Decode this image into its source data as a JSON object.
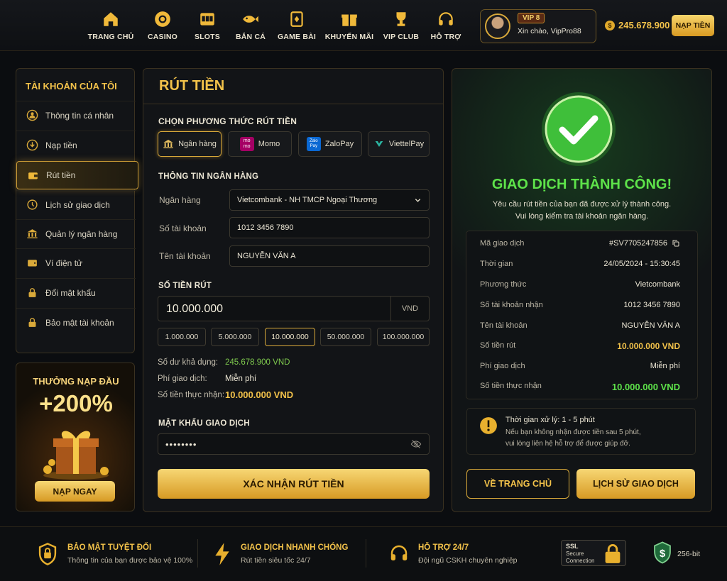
{
  "nav": [
    {
      "label": "TRANG CHỦ",
      "icon": "home-icon"
    },
    {
      "label": "CASINO",
      "icon": "chip-icon"
    },
    {
      "label": "SLOTS",
      "icon": "slot-machine-icon"
    },
    {
      "label": "BẮN CÁ",
      "icon": "fish-icon"
    },
    {
      "label": "GAME BÀI",
      "icon": "cards-icon"
    },
    {
      "label": "KHUYẾN MÃI",
      "icon": "gift-icon"
    },
    {
      "label": "VIP CLUB",
      "icon": "trophy-icon"
    },
    {
      "label": "HỖ TRỢ",
      "icon": "headset-icon"
    }
  ],
  "user": {
    "vip": "VIP 8",
    "greeting": "Xin chào, VipPro88",
    "balance": "245.678.900",
    "topup_label": "NẠP TIỀN"
  },
  "sidebar": {
    "title": "TÀI KHOẢN CỦA TÔI",
    "items": [
      {
        "label": "Thông tin cá nhân",
        "icon": "user-icon"
      },
      {
        "label": "Nạp tiền",
        "icon": "deposit-icon"
      },
      {
        "label": "Rút tiền",
        "icon": "wallet-icon",
        "active": true
      },
      {
        "label": "Lịch sử giao dịch",
        "icon": "history-icon"
      },
      {
        "label": "Quản lý ngân hàng",
        "icon": "bank-icon"
      },
      {
        "label": "Ví điện tử",
        "icon": "e-wallet-icon"
      },
      {
        "label": "Đổi mật khẩu",
        "icon": "lock-icon"
      },
      {
        "label": "Bảo mật tài khoản",
        "icon": "lock-icon"
      }
    ]
  },
  "promo": {
    "title": "THƯỞNG NẠP ĐẦU",
    "value": "+200%",
    "button": "NẠP NGAY"
  },
  "withdraw": {
    "title": "RÚT TIỀN",
    "method_heading": "CHỌN PHƯƠNG THỨC RÚT TIỀN",
    "methods": [
      {
        "label": "Ngân hàng",
        "selected": true
      },
      {
        "label": "Momo",
        "badge": "mo mo"
      },
      {
        "label": "ZaloPay",
        "badge": "Zalo Pay"
      },
      {
        "label": "ViettelPay"
      }
    ],
    "bank_heading": "THÔNG TIN NGÂN HÀNG",
    "bank_label": "Ngân hàng",
    "bank_value": "Vietcombank - NH TMCP Ngoại Thương",
    "account_no_label": "Số tài khoản",
    "account_no_value": "1012 3456 7890",
    "account_name_label": "Tên tài khoản",
    "account_name_value": "NGUYỄN VĂN A",
    "amount_heading": "SỐ TIỀN RÚT",
    "amount_value": "10.000.000",
    "currency": "VND",
    "quick_amounts": [
      "1.000.000",
      "5.000.000",
      "10.000.000",
      "50.000.000",
      "100.000.000"
    ],
    "available_label": "Số dư khả dụng:",
    "available_value": "245.678.900 VND",
    "fee_label": "Phí giao dịch:",
    "fee_value": "Miễn phí",
    "net_label": "Số tiền thực nhận:",
    "net_value": "10.000.000 VND",
    "password_heading": "MẬT KHẨU GIAO DỊCH",
    "password_value": "••••••••",
    "confirm_button": "XÁC NHẬN RÚT TIỀN"
  },
  "success": {
    "title": "GIAO DỊCH THÀNH CÔNG!",
    "line1": "Yêu cầu rút tiền của bạn đã được xử lý thành công.",
    "line2": "Vui lòng kiểm tra tài khoản ngân hàng.",
    "details": [
      {
        "label": "Mã giao dịch",
        "value": "#SV7705247856"
      },
      {
        "label": "Thời gian",
        "value": "24/05/2024 - 15:30:45"
      },
      {
        "label": "Phương thức",
        "value": "Vietcombank"
      },
      {
        "label": "Số tài khoản nhận",
        "value": "1012 3456 7890"
      },
      {
        "label": "Tên tài khoản",
        "value": "NGUYỄN VĂN A"
      },
      {
        "label": "Số tiền rút",
        "value": "10.000.000 VND"
      },
      {
        "label": "Phí giao dịch",
        "value": "Miễn phí"
      },
      {
        "label": "Số tiền thực nhận",
        "value": "10.000.000 VND"
      }
    ],
    "process_title": "Thời gian xử lý: 1 - 5 phút",
    "process_line1": "Nếu bạn không nhận được tiền sau 5 phút,",
    "process_line2": "vui lòng liên hệ hỗ trợ để được giúp đỡ.",
    "home_button": "VỀ TRANG CHỦ",
    "history_button": "LỊCH SỬ GIAO DỊCH"
  },
  "footer": [
    {
      "title": "BẢO MẬT TUYỆT ĐỐI",
      "sub": "Thông tin của bạn được bảo vệ 100%"
    },
    {
      "title": "GIAO DỊCH NHANH CHÓNG",
      "sub": "Rút tiền siêu tốc 24/7"
    },
    {
      "title": "HỖ TRỢ 24/7",
      "sub": "Đội ngũ CSKH chuyên nghiệp"
    }
  ],
  "ssl": {
    "line1": "SSL",
    "line2": "Secure",
    "line3": "Connection",
    "bits": "256-bit"
  }
}
